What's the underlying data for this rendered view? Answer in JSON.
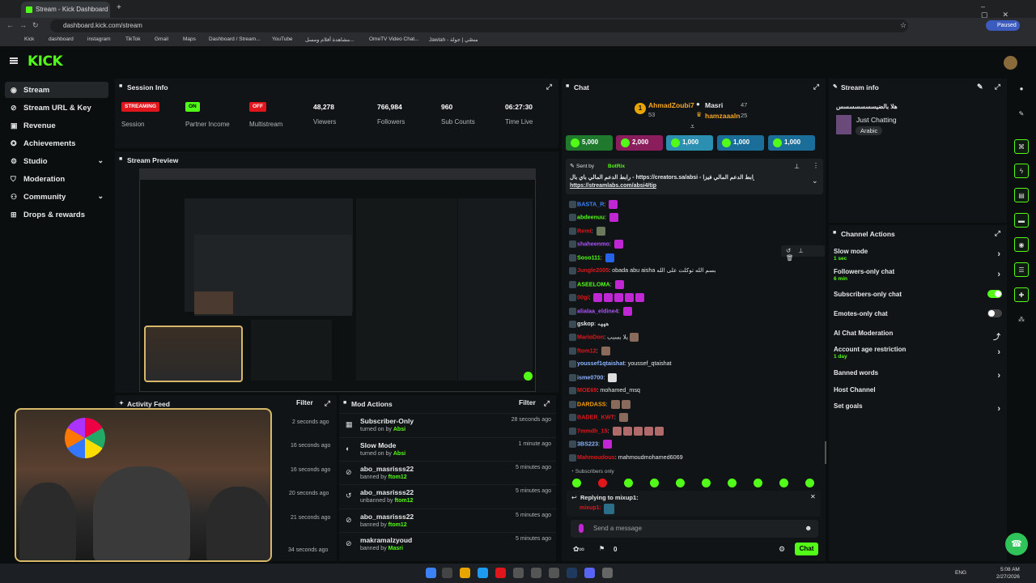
{
  "browser": {
    "tab_title": "Stream - Kick Dashboard",
    "url": "dashboard.kick.com/stream",
    "paused_label": "Paused",
    "bookmarks": [
      "Kick",
      "dashboard",
      "instagram",
      "TikTok",
      "Gmail",
      "Maps",
      "Dashboard / Stream...",
      "YouTube",
      "مشاهدة أفلام ومسل...",
      "OmeTV Video Chat...",
      "Jawlah - منصّي | جولة"
    ]
  },
  "sidebar": {
    "logo": "KICK",
    "items": [
      {
        "label": "Stream",
        "icon": "radio-icon"
      },
      {
        "label": "Stream URL & Key",
        "icon": "link-icon"
      },
      {
        "label": "Revenue",
        "icon": "dollar-icon"
      },
      {
        "label": "Achievements",
        "icon": "trophy-icon"
      },
      {
        "label": "Studio",
        "icon": "gear-icon"
      },
      {
        "label": "Moderation",
        "icon": "shield-icon"
      },
      {
        "label": "Community",
        "icon": "users-icon"
      },
      {
        "label": "Drops & rewards",
        "icon": "gift-icon"
      }
    ]
  },
  "session": {
    "title": "Session Info",
    "badges": [
      {
        "text": "STREAMING",
        "label": "Session",
        "color": "#e0161c"
      },
      {
        "text": "ON",
        "label": "Partner Income",
        "color": "#53fc18"
      },
      {
        "text": "OFF",
        "label": "Multistream",
        "color": "#e0161c"
      }
    ],
    "stats": [
      {
        "value": "48,278",
        "label": "Viewers"
      },
      {
        "value": "766,984",
        "label": "Followers"
      },
      {
        "value": "960",
        "label": "Sub Counts"
      },
      {
        "value": "06:27:30",
        "label": "Time Live"
      }
    ]
  },
  "preview": {
    "title": "Stream Preview"
  },
  "activity": {
    "title": "Activity Feed",
    "filter": "Filter",
    "times": [
      "2 seconds ago",
      "16 seconds ago",
      "16 seconds ago",
      "20 seconds ago",
      "21 seconds ago",
      "34 seconds ago"
    ]
  },
  "mod_actions": {
    "title": "Mod Actions",
    "filter": "Filter",
    "rows": [
      {
        "title": "Subscriber-Only",
        "pre": "turned on by",
        "by": "Absi",
        "time": "28 seconds ago",
        "icon": "list-icon"
      },
      {
        "title": "Slow Mode",
        "pre": "turned on by",
        "by": "Absi",
        "time": "1 minute ago",
        "icon": "slow-icon"
      },
      {
        "title": "abo_masrisss22",
        "pre": "banned by",
        "by": "ftom12",
        "time": "5 minutes ago",
        "icon": "ban-icon"
      },
      {
        "title": "abo_masrisss22",
        "pre": "unbanned by",
        "by": "ftom12",
        "time": "5 minutes ago",
        "icon": "undo-icon"
      },
      {
        "title": "abo_masrisss22",
        "pre": "banned by",
        "by": "ftom12",
        "time": "5 minutes ago",
        "icon": "ban-icon"
      },
      {
        "title": "makramalzyoud",
        "pre": "banned by",
        "by": "Masri",
        "time": "5 minutes ago",
        "icon": "ban-icon"
      }
    ]
  },
  "chat": {
    "title": "Chat",
    "leaders": [
      {
        "rank": "1",
        "name": "AhmadZoubi7",
        "count": "53"
      },
      {
        "name": "Masri",
        "count": "47"
      },
      {
        "name": "hamzaaaln",
        "count": "25"
      }
    ],
    "gifts": [
      {
        "amount": "5,000",
        "color": "#1f7a2e"
      },
      {
        "amount": "2,000",
        "color": "#8a1d5c"
      },
      {
        "amount": "1,000",
        "color": "#2a8fb0"
      },
      {
        "amount": "1,000",
        "color": "#1b6e9a"
      },
      {
        "amount": "1,000",
        "color": "#1b6e9a"
      }
    ],
    "pinned": {
      "sent_by": "Sent by",
      "bot": "BotRix",
      "text": "رابط الدعم المالي باي بال - https://creators.sa/absi - رابط الدعم المالي فيزا",
      "link2": "https://streamlabs.com/absi4/tip"
    },
    "messages": [
      {
        "user": "BASTA_R",
        "text": "",
        "color": "#3b82f6"
      },
      {
        "user": "abdeenuu",
        "text": "",
        "color": "#53fc18"
      },
      {
        "user": "Remi",
        "text": "",
        "color": "#e0161c"
      },
      {
        "user": "shaheenmo",
        "text": "",
        "color": "#a855f7"
      },
      {
        "user": "Soso111",
        "text": "",
        "color": "#53fc18"
      },
      {
        "user": "Jungle2005",
        "text": "obada abu aisha بسم الله توكلت على الله",
        "color": "#e0161c"
      },
      {
        "user": "ASEELOMA",
        "text": "",
        "color": "#53fc18"
      },
      {
        "user": "00gi",
        "text": "",
        "color": "#e0161c"
      },
      {
        "user": "alialaa_eldine4",
        "text": "",
        "color": "#a855f7"
      },
      {
        "user": "gskop",
        "text": "هههه",
        "color": "#e6e8e9"
      },
      {
        "user": "MarioDon",
        "text": "يلا بسبب",
        "color": "#e0161c"
      },
      {
        "user": "ftom12",
        "text": "",
        "color": "#e0161c"
      },
      {
        "user": "youssef1qtaishat",
        "text": "youssef_qtaishat",
        "color": "#8bb4ff"
      },
      {
        "user": "isme0700",
        "text": "",
        "color": "#8bb4ff"
      },
      {
        "user": "MOE69",
        "text": "mohamed_msq",
        "color": "#e0161c"
      },
      {
        "user": "DARDASS",
        "text": "",
        "color": "#f59e0b"
      },
      {
        "user": "BADER_KWT",
        "text": "",
        "color": "#e0161c"
      },
      {
        "user": "7mmdh_15",
        "text": "",
        "color": "#e0161c"
      },
      {
        "user": "3BS223",
        "text": "",
        "color": "#8bb4ff"
      },
      {
        "user": "Mahmoudous",
        "text": "mahmoudmohamed6069",
        "color": "#e0161c"
      }
    ],
    "subs_only": "Subscribers only",
    "replying": "Replying to mixup1:",
    "reply_user": "mixup1:",
    "placeholder": "Send a message",
    "count": "0",
    "send": "Chat"
  },
  "stream_info": {
    "title": "Stream info",
    "stream_title": "هلا بالضيسسسسسسس",
    "category": "Just Chatting",
    "language": "Arabic"
  },
  "channel_actions": {
    "title": "Channel Actions",
    "rows": [
      {
        "label": "Slow mode",
        "sub": "1 sec",
        "type": "arrow"
      },
      {
        "label": "Followers-only chat",
        "sub": "6 min",
        "type": "arrow"
      },
      {
        "label": "Subscribers-only chat",
        "sub": "",
        "type": "toggle-on"
      },
      {
        "label": "Emotes-only chat",
        "sub": "",
        "type": "toggle-off"
      },
      {
        "label": "AI Chat Moderation",
        "sub": "",
        "type": "external"
      },
      {
        "label": "Account age restriction",
        "sub": "1 day",
        "type": "arrow"
      },
      {
        "label": "Banned words",
        "sub": "",
        "type": "arrow"
      },
      {
        "label": "Host Channel",
        "sub": "",
        "type": "none"
      },
      {
        "label": "Set goals",
        "sub": "",
        "type": "arrow"
      }
    ]
  },
  "taskbar": {
    "lang": "ENG",
    "time": "5:08 AM",
    "date": "2/27/2026"
  },
  "colors": {
    "accent": "#53fc18",
    "danger": "#e0161c",
    "bg": "#0b0e0f",
    "panel": "#111416"
  }
}
